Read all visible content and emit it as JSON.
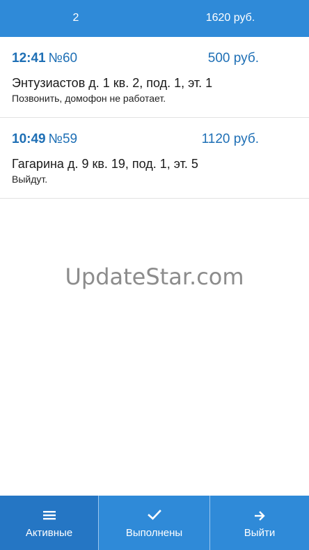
{
  "summary": {
    "count": "2",
    "total": "1620 руб."
  },
  "orders": [
    {
      "time": "12:41",
      "number": "№60",
      "price": "500 руб.",
      "address": "Энтузиастов д. 1 кв. 2, под. 1, эт. 1",
      "note": "Позвонить, домофон не работает."
    },
    {
      "time": "10:49",
      "number": "№59",
      "price": "1120 руб.",
      "address": "Гагарина д. 9 кв. 19, под. 1, эт. 5",
      "note": "Выйдут."
    }
  ],
  "watermark": "UpdateStar.com",
  "tabs": [
    {
      "label": "Активные",
      "icon": "menu-icon",
      "active": true
    },
    {
      "label": "Выполнены",
      "icon": "check-icon",
      "active": false
    },
    {
      "label": "Выйти",
      "icon": "arrow-right-icon",
      "active": false
    }
  ],
  "colors": {
    "accent": "#2f8ad8",
    "accent_active": "#2576c4",
    "link_blue": "#1e6fb5"
  }
}
